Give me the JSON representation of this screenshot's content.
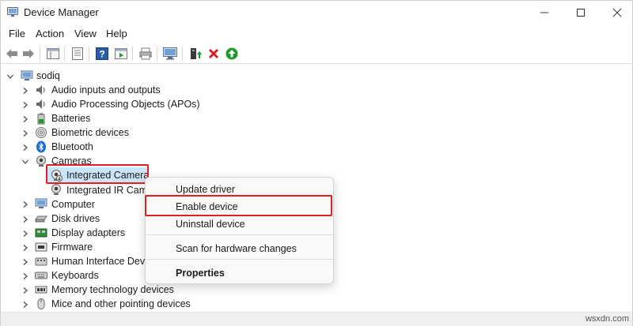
{
  "window": {
    "title": "Device Manager"
  },
  "menu": [
    "File",
    "Action",
    "View",
    "Help"
  ],
  "tree": {
    "root": "sodiq",
    "items": [
      "Audio inputs and outputs",
      "Audio Processing Objects (APOs)",
      "Batteries",
      "Biometric devices",
      "Bluetooth",
      "Cameras",
      "Integrated Camera",
      "Integrated IR Came",
      "Computer",
      "Disk drives",
      "Display adapters",
      "Firmware",
      "Human Interface Devic",
      "Keyboards",
      "Memory technology devices",
      "Mice and other pointing devices"
    ]
  },
  "context_menu": {
    "update": "Update driver",
    "enable": "Enable device",
    "uninstall": "Uninstall device",
    "scan": "Scan for hardware changes",
    "properties": "Properties"
  },
  "watermark": "wsxdn.com",
  "colors": {
    "highlight": "#cce4f7",
    "red_box": "#e02020",
    "accent_green": "#1a9a2a",
    "accent_red": "#d61f1f"
  }
}
